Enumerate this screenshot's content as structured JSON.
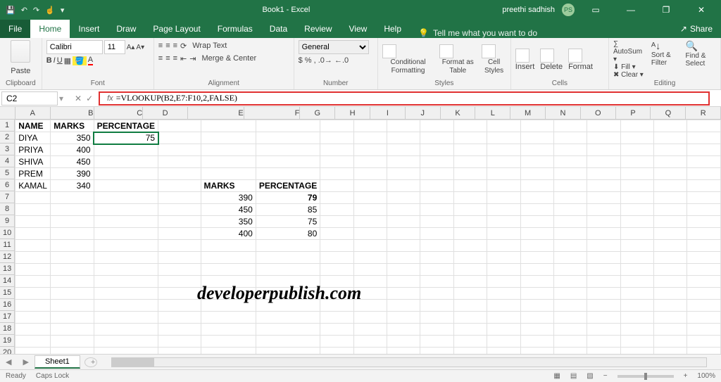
{
  "titlebar": {
    "title": "Book1 - Excel",
    "user": "preethi sadhish",
    "initials": "PS"
  },
  "tabs": {
    "file": "File",
    "home": "Home",
    "insert": "Insert",
    "draw": "Draw",
    "pageLayout": "Page Layout",
    "formulas": "Formulas",
    "data": "Data",
    "review": "Review",
    "view": "View",
    "help": "Help",
    "tellme": "Tell me what you want to do",
    "share": "Share"
  },
  "ribbon": {
    "clipboard": {
      "paste": "Paste",
      "label": "Clipboard"
    },
    "font": {
      "name": "Calibri",
      "size": "11",
      "label": "Font"
    },
    "alignment": {
      "wrap": "Wrap Text",
      "merge": "Merge & Center",
      "label": "Alignment"
    },
    "number": {
      "format": "General",
      "label": "Number"
    },
    "styles": {
      "cf": "Conditional\nFormatting",
      "fat": "Format as\nTable",
      "cs": "Cell\nStyles",
      "label": "Styles"
    },
    "cells": {
      "insert": "Insert",
      "delete": "Delete",
      "format": "Format",
      "label": "Cells"
    },
    "editing": {
      "autosum": "AutoSum",
      "fill": "Fill",
      "clear": "Clear",
      "sortfilter": "Sort &\nFilter",
      "findselect": "Find &\nSelect",
      "label": "Editing"
    }
  },
  "formulabar": {
    "namebox": "C2",
    "formula": "=VLOOKUP(B2,E7:F10,2,FALSE)"
  },
  "columns": [
    "A",
    "B",
    "C",
    "D",
    "E",
    "F",
    "G",
    "H",
    "I",
    "J",
    "K",
    "L",
    "M",
    "N",
    "O",
    "P",
    "Q",
    "R"
  ],
  "headers": {
    "name": "NAME",
    "marks": "MARKS",
    "pct": "PERCENTAGE"
  },
  "students": [
    {
      "name": "DIYA",
      "marks": 350,
      "pct": 75
    },
    {
      "name": "PRIYA",
      "marks": 400,
      "pct": ""
    },
    {
      "name": "SHIVA",
      "marks": 450,
      "pct": ""
    },
    {
      "name": "PREM",
      "marks": 390,
      "pct": ""
    },
    {
      "name": "KAMAL",
      "marks": 340,
      "pct": ""
    }
  ],
  "lookup": {
    "head_marks": "MARKS",
    "head_pct": "PERCENTAGE",
    "rows": [
      {
        "m": 390,
        "p": 79
      },
      {
        "m": 450,
        "p": 85
      },
      {
        "m": 350,
        "p": 75
      },
      {
        "m": 400,
        "p": 80
      }
    ]
  },
  "watermark": "developerpublish.com",
  "sheettab": "Sheet1",
  "status": {
    "ready": "Ready",
    "caps": "Caps Lock",
    "zoom": "100%"
  }
}
